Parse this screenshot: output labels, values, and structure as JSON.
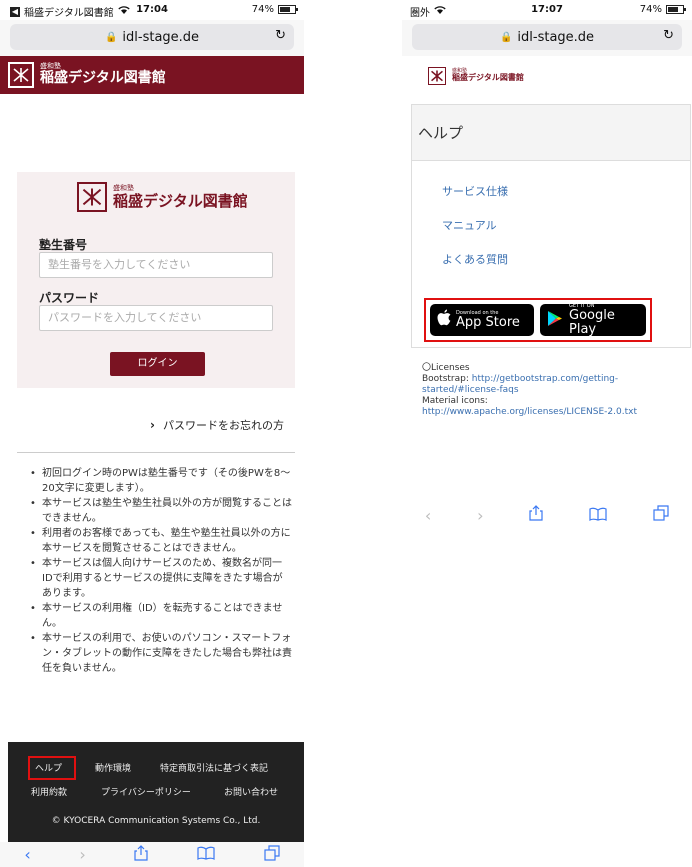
{
  "left": {
    "status": {
      "back_app": "稲盛デジタル図書館",
      "time": "17:04",
      "battery": "74%",
      "battery_level": 0.74
    },
    "url": "idl-stage.de",
    "brand": {
      "small": "盛和塾",
      "big": "稲盛デジタル図書館"
    },
    "login": {
      "id_label": "塾生番号",
      "id_placeholder": "塾生番号を入力してください",
      "password_label": "パスワード",
      "password_placeholder": "パスワードを入力してください",
      "button": "ログイン"
    },
    "forgot": "パスワードをお忘れの方",
    "notes": [
      "初回ログイン時のPWは塾生番号です（その後PWを8〜20文字に変更します）。",
      "本サービスは塾生や塾生社員以外の方が閲覧することはできません。",
      "利用者のお客様であっても、塾生や塾生社員以外の方に本サービスを閲覧させることはできません。",
      "本サービスは個人向けサービスのため、複数名が同一IDで利用するとサービスの提供に支障をきたす場合があります。",
      "本サービスの利用権（ID）を転売することはできません。",
      "本サービスの利用で、お使いのパソコン・スマートフォン・タブレットの動作に支障をきたした場合も弊社は責任を負いません。"
    ],
    "footer": {
      "help": "ヘルプ",
      "environment": "動作環境",
      "tokushoho": "特定商取引法に基づく表記",
      "terms": "利用約款",
      "privacy": "プライバシーポリシー",
      "contact": "お問い合わせ",
      "copyright": "© KYOCERA Communication Systems Co., Ltd."
    }
  },
  "right": {
    "status": {
      "carrier": "圏外",
      "time": "17:07",
      "battery": "74%",
      "battery_level": 0.74
    },
    "url": "idl-stage.de",
    "brand": {
      "small": "盛和塾",
      "big": "稲盛デジタル図書館"
    },
    "help_title": "ヘルプ",
    "links": [
      "サービス仕様",
      "マニュアル",
      "よくある質問"
    ],
    "app_store": {
      "small": "Download on the",
      "big": "App Store"
    },
    "google_play": {
      "small": "GET IT ON",
      "big": "Google Play"
    },
    "licenses": {
      "heading": "〇Licenses",
      "bootstrap_label": "Bootstrap:",
      "bootstrap_url": "http://getbootstrap.com/getting-started/#license-faqs",
      "material_label": "Material icons:",
      "material_url": "http://www.apache.org/licenses/LICENSE-2.0.txt"
    }
  }
}
